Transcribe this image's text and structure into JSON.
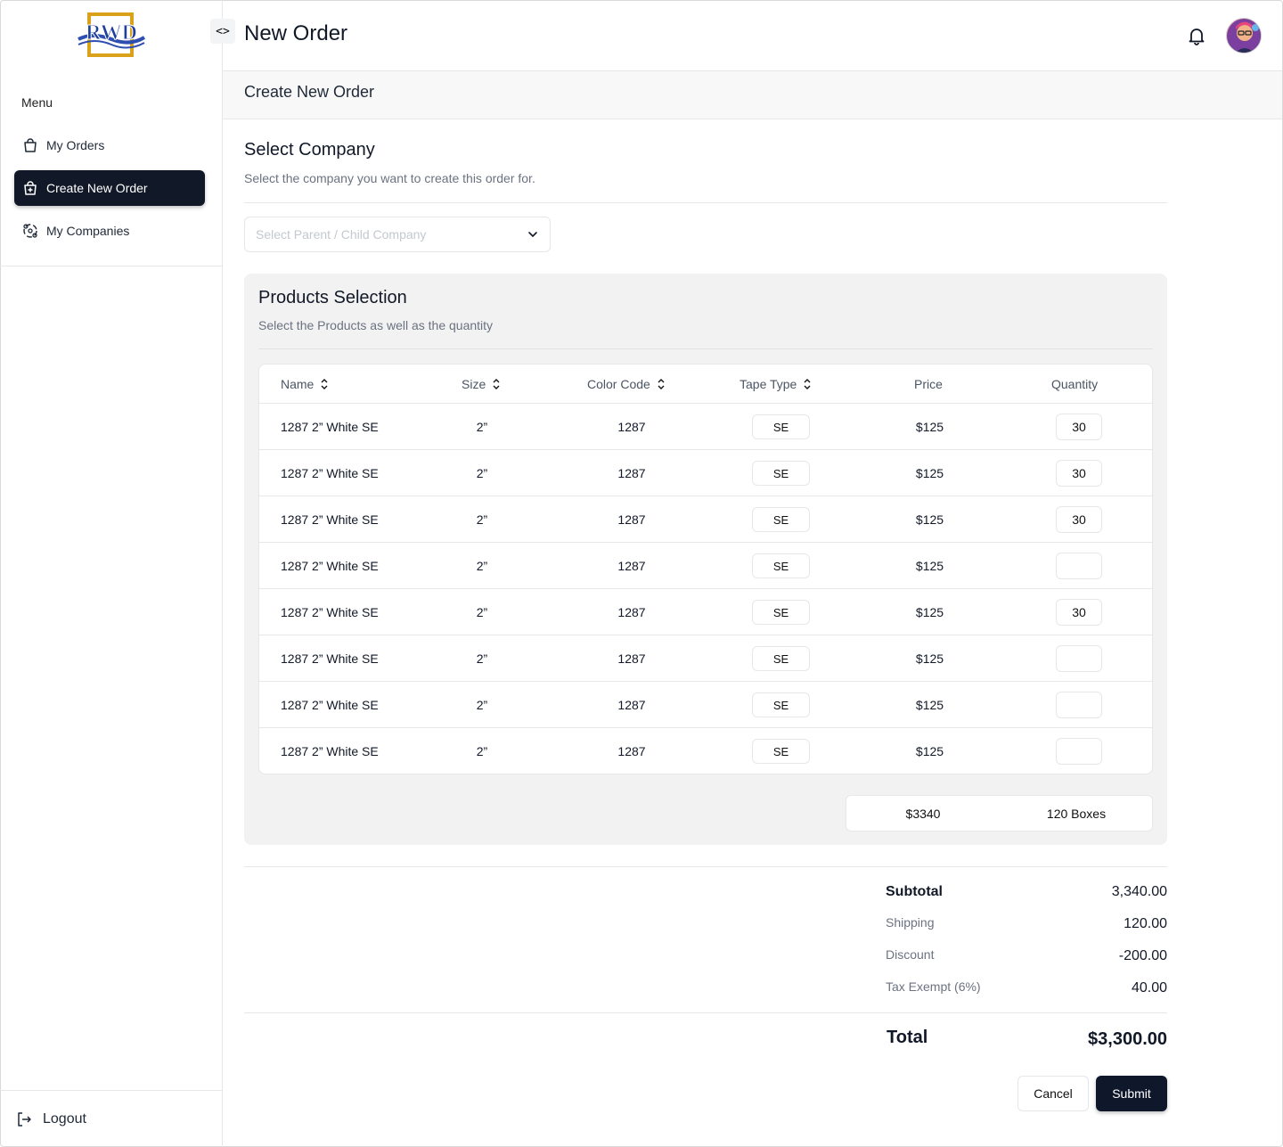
{
  "brand": {
    "logo_text": "RWD"
  },
  "header": {
    "title": "New Order",
    "toggle_glyph": "<>"
  },
  "sidebar": {
    "menu_label": "Menu",
    "items": [
      {
        "label": "My Orders",
        "icon": "bag-icon",
        "active": false
      },
      {
        "label": "Create New Order",
        "icon": "bag-plus-icon",
        "active": true
      },
      {
        "label": "My Companies",
        "icon": "companies-icon",
        "active": false
      }
    ],
    "logout_label": "Logout"
  },
  "subheader": {
    "title": "Create New Order"
  },
  "company": {
    "title": "Select Company",
    "subtitle": "Select the company you want to create this order for.",
    "placeholder": "Select Parent / Child Company"
  },
  "products": {
    "title": "Products Selection",
    "subtitle": "Select the Products as well as the quantity",
    "columns": [
      "Name",
      "Size",
      "Color Code",
      "Tape Type",
      "Price",
      "Quantity"
    ],
    "rows": [
      {
        "name": "1287 2” White SE",
        "size": "2”",
        "code": "1287",
        "tape": "SE",
        "price": "$125",
        "qty": "30"
      },
      {
        "name": "1287 2” White SE",
        "size": "2”",
        "code": "1287",
        "tape": "SE",
        "price": "$125",
        "qty": "30"
      },
      {
        "name": "1287 2” White SE",
        "size": "2”",
        "code": "1287",
        "tape": "SE",
        "price": "$125",
        "qty": "30"
      },
      {
        "name": "1287 2” White SE",
        "size": "2”",
        "code": "1287",
        "tape": "SE",
        "price": "$125",
        "qty": ""
      },
      {
        "name": "1287 2” White SE",
        "size": "2”",
        "code": "1287",
        "tape": "SE",
        "price": "$125",
        "qty": "30"
      },
      {
        "name": "1287 2” White SE",
        "size": "2”",
        "code": "1287",
        "tape": "SE",
        "price": "$125",
        "qty": ""
      },
      {
        "name": "1287 2” White SE",
        "size": "2”",
        "code": "1287",
        "tape": "SE",
        "price": "$125",
        "qty": ""
      },
      {
        "name": "1287 2” White SE",
        "size": "2”",
        "code": "1287",
        "tape": "SE",
        "price": "$125",
        "qty": ""
      }
    ],
    "total_amount": "$3340",
    "total_boxes": "120 Boxes"
  },
  "summary": {
    "subtotal_label": "Subtotal",
    "subtotal": "3,340.00",
    "shipping_label": "Shipping",
    "shipping": "120.00",
    "discount_label": "Discount",
    "discount": "-200.00",
    "tax_label": "Tax Exempt (6%)",
    "tax": "40.00",
    "total_label": "Total",
    "total": "$3,300.00"
  },
  "actions": {
    "cancel": "Cancel",
    "submit": "Submit"
  },
  "colors": {
    "primary": "#111827",
    "panel": "#f2f2f2",
    "border": "#e5e7eb",
    "muted": "#6b7280"
  }
}
